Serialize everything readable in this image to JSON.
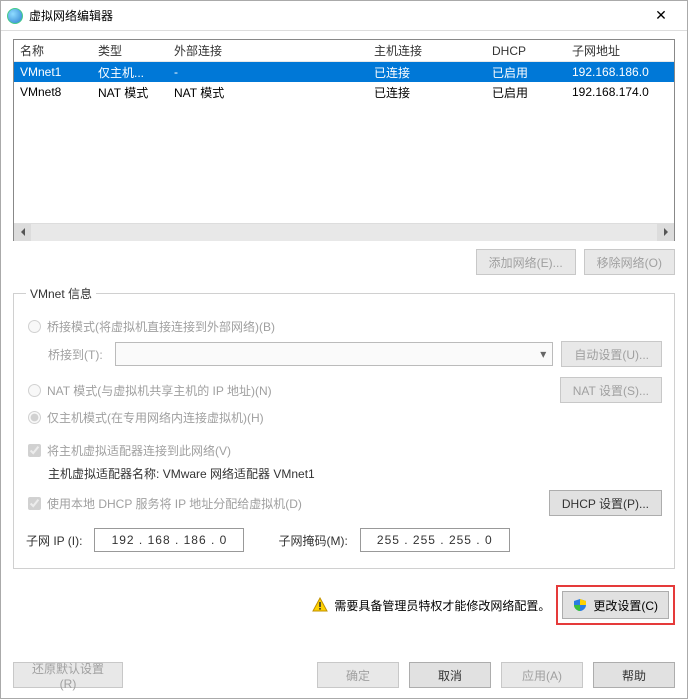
{
  "window": {
    "title": "虚拟网络编辑器"
  },
  "table": {
    "headers": {
      "name": "名称",
      "type": "类型",
      "external": "外部连接",
      "host": "主机连接",
      "dhcp": "DHCP",
      "subnet": "子网地址"
    },
    "rows": [
      {
        "name": "VMnet1",
        "type": "仅主机...",
        "external": "-",
        "host": "已连接",
        "dhcp": "已启用",
        "subnet": "192.168.186.0",
        "selected": true
      },
      {
        "name": "VMnet8",
        "type": "NAT 模式",
        "external": "NAT 模式",
        "host": "已连接",
        "dhcp": "已启用",
        "subnet": "192.168.174.0",
        "selected": false
      }
    ]
  },
  "buttons": {
    "add_network": "添加网络(E)...",
    "remove_network": "移除网络(O)",
    "auto_settings": "自动设置(U)...",
    "nat_settings": "NAT 设置(S)...",
    "dhcp_settings": "DHCP 设置(P)...",
    "change_settings": "更改设置(C)",
    "restore_defaults": "还原默认设置(R)",
    "ok": "确定",
    "cancel": "取消",
    "apply": "应用(A)",
    "help": "帮助"
  },
  "group": {
    "legend": "VMnet 信息",
    "bridged_mode": "桥接模式(将虚拟机直接连接到外部网络)(B)",
    "bridged_to": "桥接到(T):",
    "nat_mode": "NAT 模式(与虚拟机共享主机的 IP 地址)(N)",
    "hostonly_mode": "仅主机模式(在专用网络内连接虚拟机)(H)",
    "connect_host_adapter": "将主机虚拟适配器连接到此网络(V)",
    "host_adapter_name_label": "主机虚拟适配器名称:",
    "host_adapter_name": "VMware 网络适配器 VMnet1",
    "use_local_dhcp": "使用本地 DHCP 服务将 IP 地址分配给虚拟机(D)",
    "subnet_ip_label": "子网 IP (I):",
    "subnet_ip": "192 . 168 . 186 .  0",
    "subnet_mask_label": "子网掩码(M):",
    "subnet_mask": "255 . 255 . 255 .  0"
  },
  "warning": "需要具备管理员特权才能修改网络配置。"
}
